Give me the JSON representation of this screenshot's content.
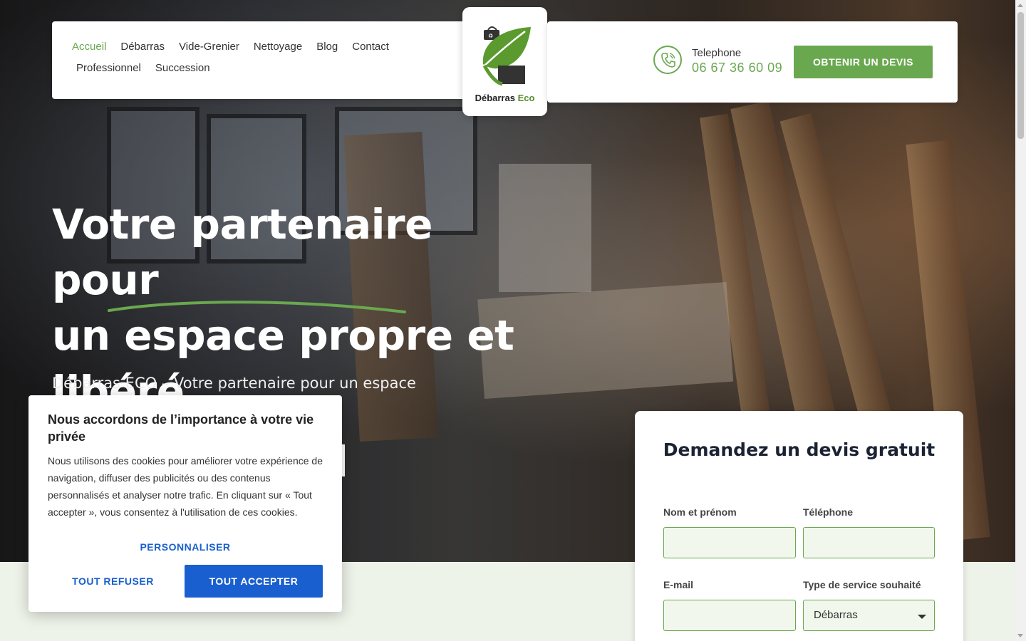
{
  "nav": {
    "items": [
      {
        "label": "Accueil"
      },
      {
        "label": "Débarras"
      },
      {
        "label": "Vide-Grenier"
      },
      {
        "label": "Nettoyage"
      },
      {
        "label": "Blog"
      },
      {
        "label": "Contact"
      },
      {
        "label": "Professionnel"
      },
      {
        "label": "Succession"
      }
    ],
    "active_color": "#6aa84f"
  },
  "logo": {
    "name_main": "Débarras",
    "name_accent": "Eco",
    "brand_color": "#5a8d2e"
  },
  "contact": {
    "label": "Telephone",
    "number": "06 67 36 60 09",
    "cta": "OBTENIR UN DEVIS",
    "icon": "phone-icon"
  },
  "hero": {
    "title_line1": "Votre partenaire pour",
    "title_line2": "un espace propre et",
    "title_line3": "libéré",
    "subtitle": "Débarras ECO – Votre partenaire pour un espace"
  },
  "cookie": {
    "title": "Nous accordons de l’importance à votre vie privée",
    "text": "Nous utilisons des cookies pour améliorer votre expérience de navigation, diffuser des publicités ou des contenus personnalisés et analyser notre trafic. En cliquant sur « Tout accepter », vous consentez à l'utilisation de ces cookies.",
    "customize": "PERSONNALISER",
    "refuse": "TOUT REFUSER",
    "accept": "TOUT ACCEPTER",
    "accent_color": "#1a5fcf"
  },
  "quote_form": {
    "title": "Demandez un devis gratuit",
    "name_label": "Nom et prénom",
    "phone_label": "Téléphone",
    "email_label": "E-mail",
    "service_label": "Type de service souhaité",
    "service_selected": "Débarras"
  },
  "colors": {
    "accent_green": "#6aa84f",
    "light_green_bg": "#eef3e9"
  }
}
